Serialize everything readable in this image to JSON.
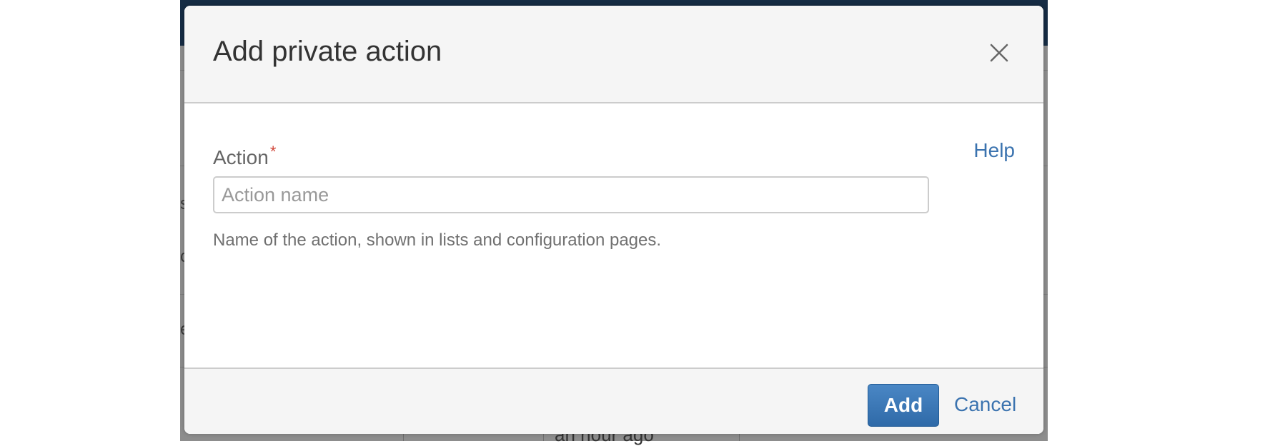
{
  "background": {
    "left_fragments": [
      "s",
      "c",
      "e"
    ],
    "bottom_text": "an hour ago",
    "bottom_text2": "..."
  },
  "dialog": {
    "title": "Add private action",
    "close_icon": "close-icon",
    "help_label": "Help",
    "field": {
      "label": "Action",
      "required_mark": "*",
      "placeholder": "Action name",
      "value": "",
      "description": "Name of the action, shown in lists and configuration pages."
    },
    "footer": {
      "add_label": "Add",
      "cancel_label": "Cancel"
    }
  },
  "colors": {
    "link": "#3b73af",
    "primary_button": "#3b7bbf",
    "required": "#d04437",
    "overlay_top": "#162c44"
  }
}
